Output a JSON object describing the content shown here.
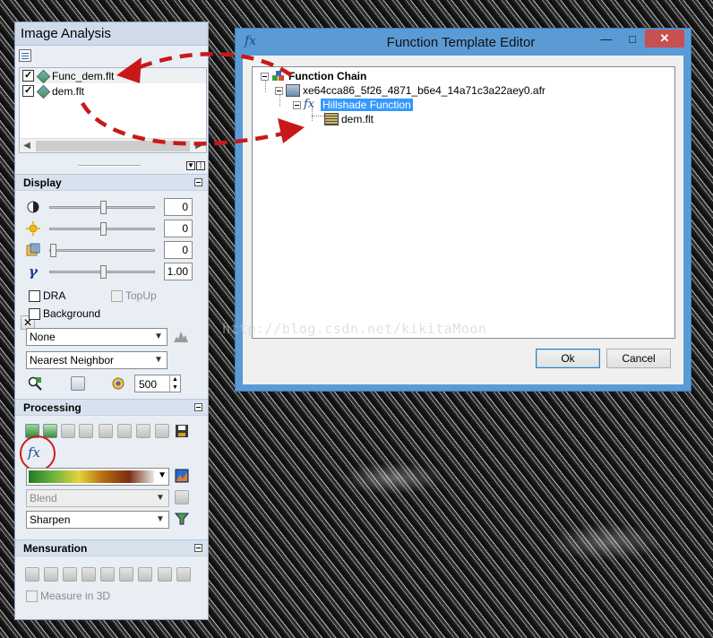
{
  "image_analysis": {
    "title": "Image Analysis",
    "layers": [
      {
        "name": "Func_dem.flt",
        "checked": true
      },
      {
        "name": "dem.flt",
        "checked": true
      }
    ],
    "display": {
      "header": "Display",
      "sliders": [
        {
          "icon": "contrast-icon",
          "value": "0"
        },
        {
          "icon": "brightness-icon",
          "value": "0"
        },
        {
          "icon": "transparency-icon",
          "value": "0"
        },
        {
          "icon": "gamma-icon",
          "value": "1.00"
        }
      ],
      "dra_label": "DRA",
      "topup_label": "TopUp",
      "background_label": "Background",
      "stretch_value": "None",
      "resampling_value": "Nearest Neighbor",
      "scale_value": "500"
    },
    "processing": {
      "header": "Processing",
      "blend_value": "Blend",
      "sharpen_value": "Sharpen"
    },
    "mensuration": {
      "header": "Mensuration",
      "measure_3d_label": "Measure in 3D"
    }
  },
  "function_template_editor": {
    "title": "Function Template Editor",
    "tree": {
      "root": "Function Chain",
      "raster": "xe64cca86_5f26_4871_b6e4_14a71c3a22aey0.afr",
      "function": "Hillshade Function",
      "input": "dem.flt"
    },
    "ok_label": "Ok",
    "cancel_label": "Cancel"
  },
  "watermark": "http://blog.csdn.net/kikitaMoon",
  "colors": {
    "annotation_red": "#c81818",
    "selection_blue": "#3399ff",
    "window_border": "#5b9bd5"
  }
}
